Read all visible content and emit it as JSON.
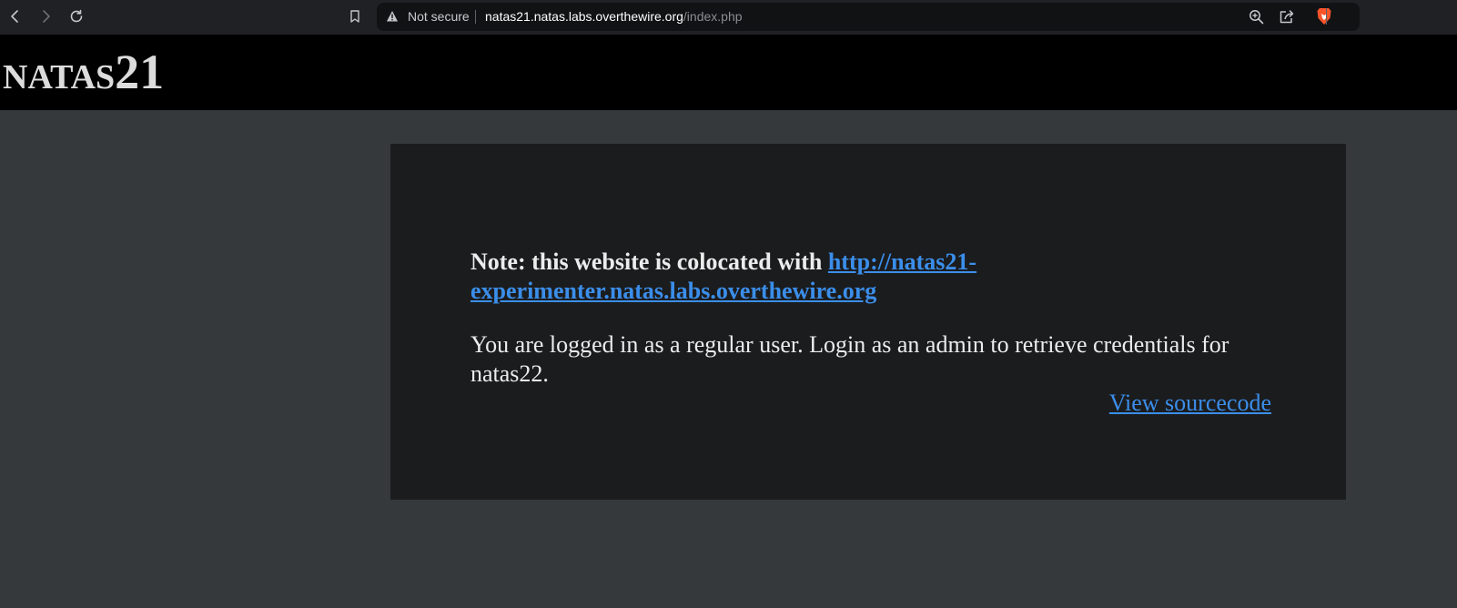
{
  "browser": {
    "security_label": "Not secure",
    "url_host": "natas21.natas.labs.overthewire.org",
    "url_path": "/index.php",
    "icons": [
      "back-icon",
      "forward-icon",
      "reload-icon",
      "bookmark-icon",
      "warning-icon",
      "zoom-icon",
      "share-icon",
      "brave-shield-icon"
    ]
  },
  "page": {
    "title": "natas21",
    "note_prefix": "Note: this website is colocated with",
    "colocated_link": "http://natas21-experimenter.natas.labs.overthewire.org",
    "status_text": "You are logged in as a regular user. Login as an admin to retrieve credentials for natas22.",
    "source_link": "View sourcecode"
  },
  "colors": {
    "header_bg": "#000000",
    "page_bg": "#35393c",
    "content_bg": "#1b1c1e",
    "link": "#3b8eea"
  }
}
